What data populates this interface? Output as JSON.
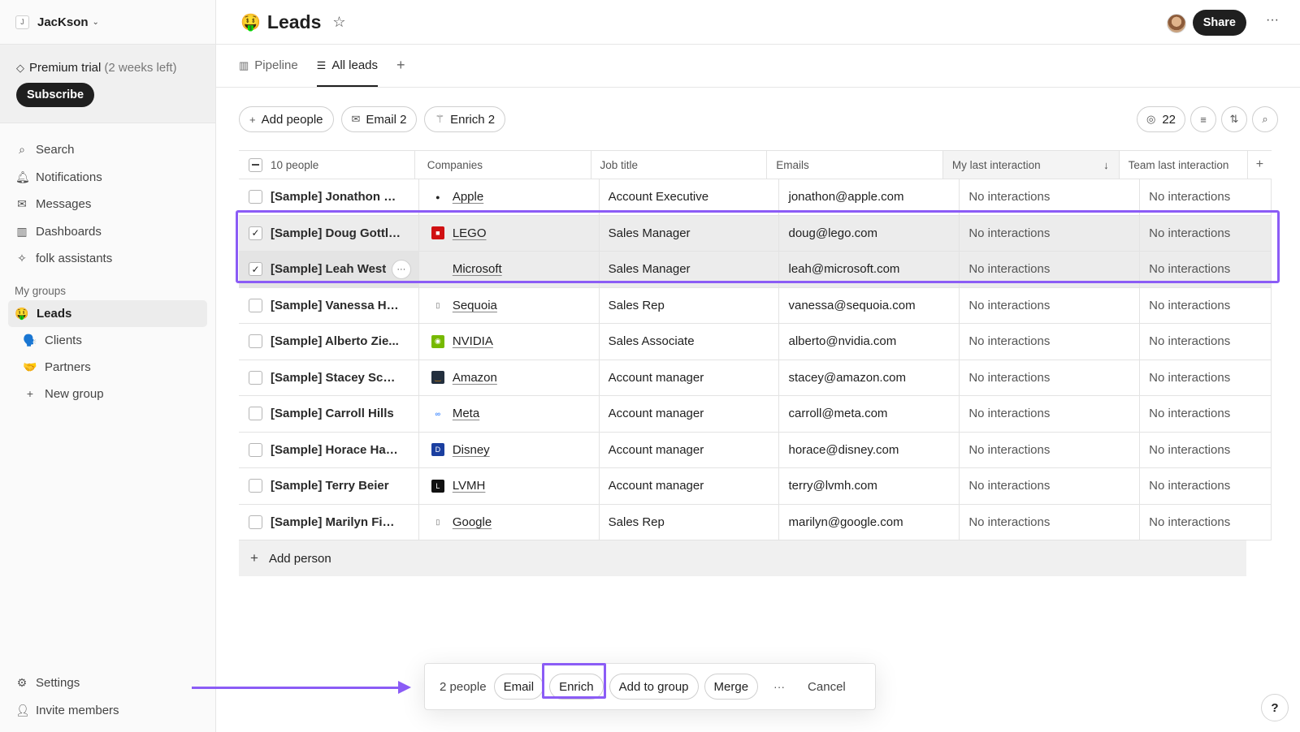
{
  "workspace": {
    "logo": "J",
    "name": "JacKson"
  },
  "trial": {
    "label": "Premium trial",
    "remaining": "(2 weeks left)",
    "subscribe_label": "Subscribe"
  },
  "nav": [
    {
      "label": "Search",
      "icon": "search-icon"
    },
    {
      "label": "Notifications",
      "icon": "bell-icon"
    },
    {
      "label": "Messages",
      "icon": "mail-icon"
    },
    {
      "label": "Dashboards",
      "icon": "chart-icon"
    },
    {
      "label": "folk assistants",
      "icon": "assistant-icon"
    }
  ],
  "groups": {
    "title": "My groups",
    "items": [
      {
        "label": "Leads",
        "emoji": "🤑"
      },
      {
        "label": "Clients",
        "emoji": "🗣️"
      },
      {
        "label": "Partners",
        "emoji": "🤝"
      }
    ],
    "new_group": "New group"
  },
  "bottom_nav": [
    {
      "label": "Settings",
      "icon": "gear-icon"
    },
    {
      "label": "Invite members",
      "icon": "add-user-icon"
    }
  ],
  "header": {
    "emoji": "🤑",
    "title": "Leads",
    "share_label": "Share"
  },
  "tabs": [
    {
      "label": "Pipeline",
      "icon": "board-icon"
    },
    {
      "label": "All leads",
      "icon": "table-icon"
    }
  ],
  "toolbar": {
    "add_people": "Add people",
    "email": "Email 2",
    "enrich": "Enrich 2",
    "hidden_count": "22"
  },
  "table": {
    "headers": [
      "10 people",
      "Companies",
      "Job title",
      "Emails",
      "My last interaction",
      "Team last interaction"
    ],
    "rows": [
      {
        "name": "[Sample] Jonathon Ku...",
        "company": "Apple",
        "job": "Account Executive",
        "email": "jonathon@apple.com",
        "my": "No interactions",
        "team": "No interactions",
        "selected": false
      },
      {
        "name": "[Sample] Doug Gottlieb",
        "company": "LEGO",
        "job": "Sales Manager",
        "email": "doug@lego.com",
        "my": "No interactions",
        "team": "No interactions",
        "selected": true
      },
      {
        "name": "[Sample] Leah West",
        "company": "Microsoft",
        "job": "Sales Manager",
        "email": "leah@microsoft.com",
        "my": "No interactions",
        "team": "No interactions",
        "selected": true
      },
      {
        "name": "[Sample] Vanessa Hic...",
        "company": "Sequoia",
        "job": "Sales Rep",
        "email": "vanessa@sequoia.com",
        "my": "No interactions",
        "team": "No interactions",
        "selected": false
      },
      {
        "name": "[Sample] Alberto Zie...",
        "company": "NVIDIA",
        "job": "Sales Associate",
        "email": "alberto@nvidia.com",
        "my": "No interactions",
        "team": "No interactions",
        "selected": false
      },
      {
        "name": "[Sample] Stacey Schu...",
        "company": "Amazon",
        "job": "Account manager",
        "email": "stacey@amazon.com",
        "my": "No interactions",
        "team": "No interactions",
        "selected": false
      },
      {
        "name": "[Sample] Carroll Hills",
        "company": "Meta",
        "job": "Account manager",
        "email": "carroll@meta.com",
        "my": "No interactions",
        "team": "No interactions",
        "selected": false
      },
      {
        "name": "[Sample] Horace Hamill",
        "company": "Disney",
        "job": "Account manager",
        "email": "horace@disney.com",
        "my": "No interactions",
        "team": "No interactions",
        "selected": false
      },
      {
        "name": "[Sample] Terry Beier",
        "company": "LVMH",
        "job": "Account manager",
        "email": "terry@lvmh.com",
        "my": "No interactions",
        "team": "No interactions",
        "selected": false
      },
      {
        "name": "[Sample] Marilyn Fisher",
        "company": "Google",
        "job": "Sales Rep",
        "email": "marilyn@google.com",
        "my": "No interactions",
        "team": "No interactions",
        "selected": false
      }
    ],
    "add_person": "Add person"
  },
  "actionbar": {
    "count": "2 people",
    "email": "Email",
    "enrich": "Enrich",
    "add_to_group": "Add to group",
    "merge": "Merge",
    "more": "···",
    "cancel": "Cancel"
  },
  "help": "?",
  "colors": {
    "highlight": "#8b5cf6",
    "primary_dark": "#1f1f1f"
  }
}
